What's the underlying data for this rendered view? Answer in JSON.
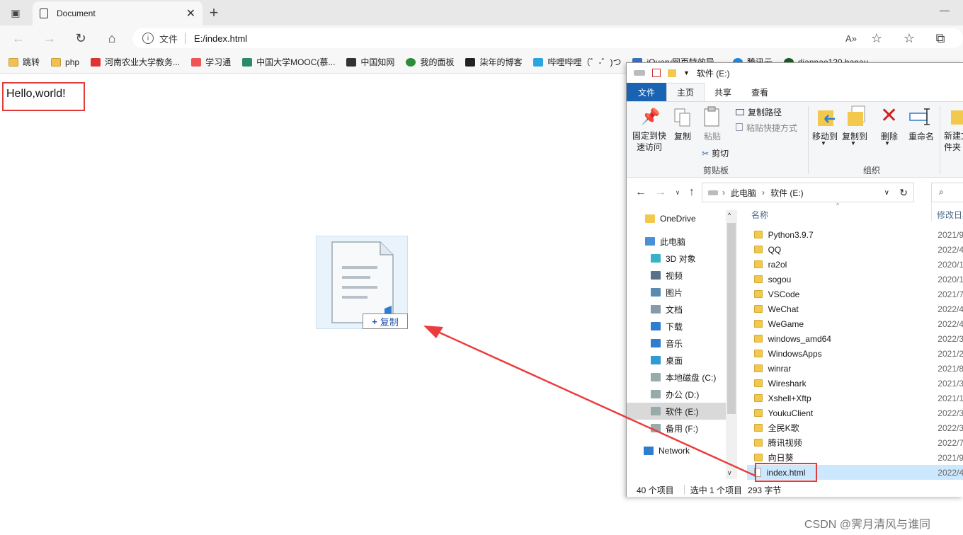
{
  "browser": {
    "tab_title": "Document",
    "address_scheme": "文件",
    "address_url": "E:/index.html",
    "bookmarks": [
      "跳转",
      "php",
      "河南农业大学教务...",
      "学习通",
      "中国大学MOOC(慕...",
      "中国知网",
      "我的面板",
      "柒年的博客",
      "哔哩哔哩（゜-゜)つ",
      "jQuery网页特效导...",
      "腾讯云",
      "diannao120.hanau..."
    ]
  },
  "page": {
    "text": "Hello,world!"
  },
  "drag": {
    "badge_label": "复制",
    "badge_icon": "plus-icon"
  },
  "explorer": {
    "title": "软件 (E:)",
    "ribbon_tabs": [
      "文件",
      "主页",
      "共享",
      "查看"
    ],
    "ribbon": {
      "pin_label": "固定到快速访问",
      "copy_label": "复制",
      "paste_label": "粘贴",
      "copy_path": "复制路径",
      "paste_shortcut": "粘贴快捷方式",
      "cut": "剪切",
      "clipboard_group": "剪贴板",
      "move_to": "移动到",
      "copy_to": "复制到",
      "delete": "删除",
      "rename": "重命名",
      "organize_group": "组织",
      "new_folder": "新建文件夹"
    },
    "breadcrumb": [
      "此电脑",
      "软件 (E:)"
    ],
    "columns": {
      "name": "名称",
      "date": "修改日期"
    },
    "nav_items": [
      "OneDrive",
      "此电脑",
      "3D 对象",
      "视频",
      "图片",
      "文档",
      "下载",
      "音乐",
      "桌面",
      "本地磁盘 (C:)",
      "办公 (D:)",
      "软件 (E:)",
      "备用 (F:)",
      "Network"
    ],
    "files": [
      {
        "name": "Python3.9.7",
        "date": "2021/9"
      },
      {
        "name": "QQ",
        "date": "2022/4"
      },
      {
        "name": "ra2ol",
        "date": "2020/1"
      },
      {
        "name": "sogou",
        "date": "2020/1"
      },
      {
        "name": "VSCode",
        "date": "2021/7"
      },
      {
        "name": "WeChat",
        "date": "2022/4"
      },
      {
        "name": "WeGame",
        "date": "2022/4"
      },
      {
        "name": "windows_amd64",
        "date": "2022/3"
      },
      {
        "name": "WindowsApps",
        "date": "2021/2"
      },
      {
        "name": "winrar",
        "date": "2021/8"
      },
      {
        "name": "Wireshark",
        "date": "2021/3"
      },
      {
        "name": "Xshell+Xftp",
        "date": "2021/1"
      },
      {
        "name": "YoukuClient",
        "date": "2022/3"
      },
      {
        "name": "全民K歌",
        "date": "2022/3"
      },
      {
        "name": "腾讯视频",
        "date": "2022/7"
      },
      {
        "name": "向日葵",
        "date": "2021/9"
      },
      {
        "name": "index.html",
        "date": "2022/4"
      }
    ],
    "status_count": "40 个项目",
    "status_selected": "选中 1 个项目",
    "status_size": "293 字节"
  },
  "watermark": "CSDN @霁月清风与谁同"
}
